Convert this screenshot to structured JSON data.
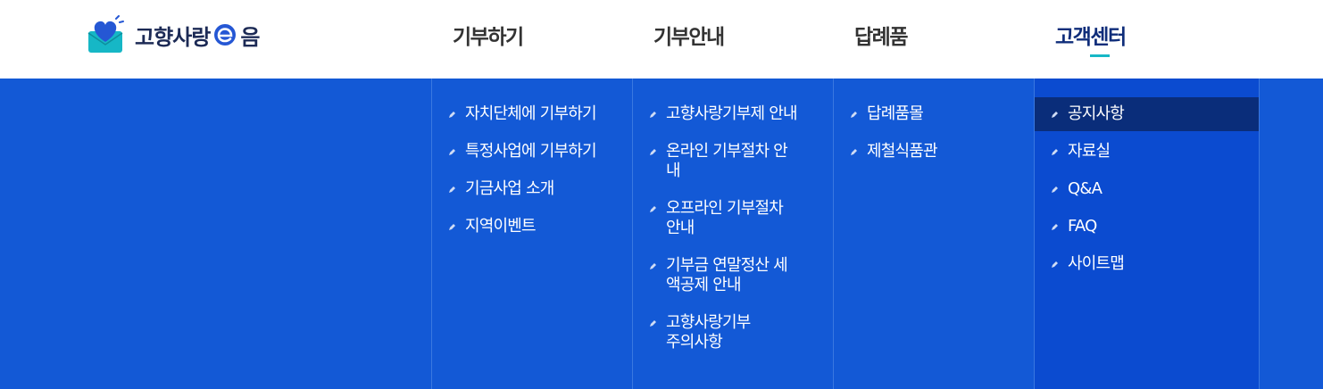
{
  "brand": {
    "name_part1": "고향사랑",
    "name_part2": "음",
    "colors": {
      "heart": "#2557d4",
      "envelope": "#16b7c6",
      "text": "#1c2a55"
    }
  },
  "nav": {
    "items": [
      {
        "label": "기부하기",
        "active": false
      },
      {
        "label": "기부안내",
        "active": false
      },
      {
        "label": "답례품",
        "active": false
      },
      {
        "label": "고객센터",
        "active": true
      }
    ],
    "accent_color": "#16b7c6"
  },
  "menu": {
    "columns": [
      {
        "items": [
          {
            "label": "자치단체에 기부하기"
          },
          {
            "label": "특정사업에 기부하기"
          },
          {
            "label": "기금사업 소개"
          },
          {
            "label": "지역이벤트"
          }
        ]
      },
      {
        "items": [
          {
            "label": "고향사랑기부제 안내"
          },
          {
            "label": "온라인 기부절차 안내"
          },
          {
            "label": "오프라인 기부절차 안내"
          },
          {
            "label": "기부금 연말정산 세액공제 안내"
          },
          {
            "label": "고향사랑기부 주의사항"
          }
        ]
      },
      {
        "items": [
          {
            "label": "답례품몰"
          },
          {
            "label": "제철식품관"
          }
        ]
      },
      {
        "items": [
          {
            "label": "공지사항",
            "active": true
          },
          {
            "label": "자료실"
          },
          {
            "label": "Q&A"
          },
          {
            "label": "FAQ"
          },
          {
            "label": "사이트맵"
          }
        ]
      }
    ],
    "bg_color": "#1359d6"
  }
}
